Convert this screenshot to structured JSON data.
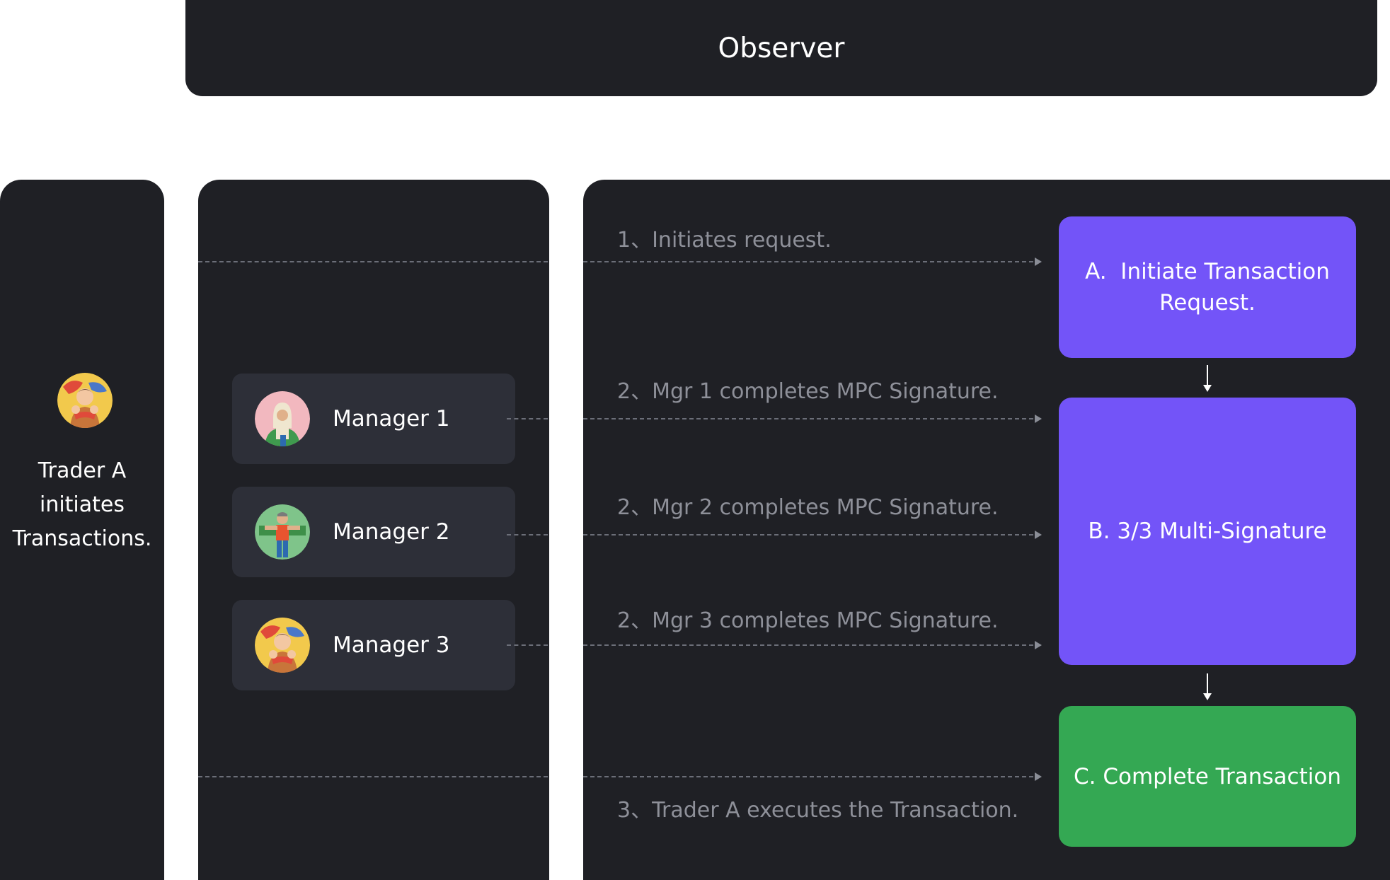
{
  "observer": {
    "label": "Observer"
  },
  "trader": {
    "label_line1": "Trader A",
    "label_line2": "initiates",
    "label_line3": "Transactions.",
    "avatar_icon": "trader-avatar-icon"
  },
  "managers": [
    {
      "name": "Manager 1",
      "avatar_icon": "manager-1-avatar-icon"
    },
    {
      "name": "Manager 2",
      "avatar_icon": "manager-2-avatar-icon"
    },
    {
      "name": "Manager 3",
      "avatar_icon": "manager-3-avatar-icon"
    }
  ],
  "steps": {
    "initiate": "1、Initiates request.",
    "mgr1": "2、Mgr 1 completes MPC Signature.",
    "mgr2": "2、Mgr 2 completes MPC Signature.",
    "mgr3": "2、Mgr 3 completes MPC Signature.",
    "execute": "3、Trader A executes the Transaction."
  },
  "boxes": {
    "a_line1": "A.  Initiate Transaction",
    "a_line2": "Request.",
    "b": "B. 3/3 Multi-Signature",
    "c": "C. Complete Transaction"
  },
  "colors": {
    "panel": "#1f2025",
    "card": "#2d2f38",
    "purple": "#7354f8",
    "green": "#34a853"
  }
}
